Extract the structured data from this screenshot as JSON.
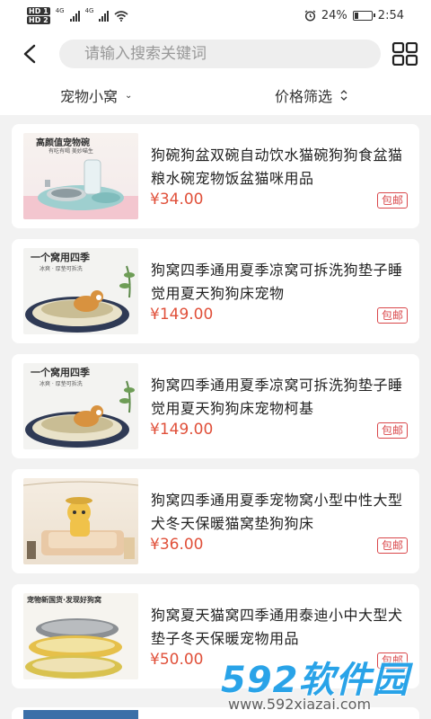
{
  "status_bar": {
    "hd_top": "HD 1",
    "hd_bottom": "HD 2",
    "net1": "4G",
    "net2": "4G",
    "battery_percent": "24%",
    "battery_level": 0.24,
    "time": "2:54"
  },
  "search": {
    "placeholder": "请输入搜索关键词"
  },
  "filters": {
    "category": "宠物小窝",
    "price": "价格筛选"
  },
  "products": [
    {
      "title": "狗碗狗盆双碗自动饮水猫碗狗狗食盆猫粮水碗宠物饭盆猫咪用品",
      "price": "¥34.00",
      "badge": "包邮",
      "img_caption": "高颜值宠物碗",
      "img_sub": "有吃有喝 美妙喵生"
    },
    {
      "title": "狗窝四季通用夏季凉窝可拆洗狗垫子睡觉用夏天狗狗床宠物",
      "price": "¥149.00",
      "badge": "包邮",
      "img_caption": "一个窝用四季",
      "img_sub": "冰爽 · 厚垫可拆洗"
    },
    {
      "title": "狗窝四季通用夏季凉窝可拆洗狗垫子睡觉用夏天狗狗床宠物柯基",
      "price": "¥149.00",
      "badge": "包邮",
      "img_caption": "一个窝用四季",
      "img_sub": "冰爽 · 厚垫可拆洗"
    },
    {
      "title": "狗窝四季通用夏季宠物窝小型中性大型犬冬天保暖猫窝垫狗狗床",
      "price": "¥36.00",
      "badge": "包邮",
      "img_caption": "",
      "img_sub": ""
    },
    {
      "title": "狗窝夏天猫窝四季通用泰迪小中大型犬垫子冬天保暖宠物用品",
      "price": "¥50.00",
      "badge": "包邮",
      "img_caption": "宠物新国货·发现好狗窝",
      "img_sub": ""
    }
  ],
  "watermark": {
    "logo": "592软件园",
    "url": "www.592xiazai.com"
  }
}
